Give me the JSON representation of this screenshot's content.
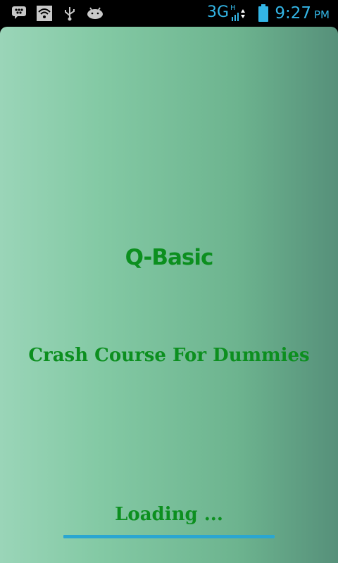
{
  "status_bar": {
    "network": "3G",
    "network_sub": "H",
    "time": "9:27",
    "ampm": "PM",
    "icons": [
      "bbm-icon",
      "wifi-icon",
      "usb-icon",
      "android-debug-icon",
      "signal-icon",
      "battery-icon"
    ],
    "accent_color": "#33b5e5"
  },
  "splash": {
    "title": "Q-Basic",
    "subtitle": "Crash Course For Dummies",
    "loading_label": "Loading ...",
    "progress": 1.0,
    "text_color": "#0c8f1f",
    "progress_color": "#2aa6d1"
  }
}
